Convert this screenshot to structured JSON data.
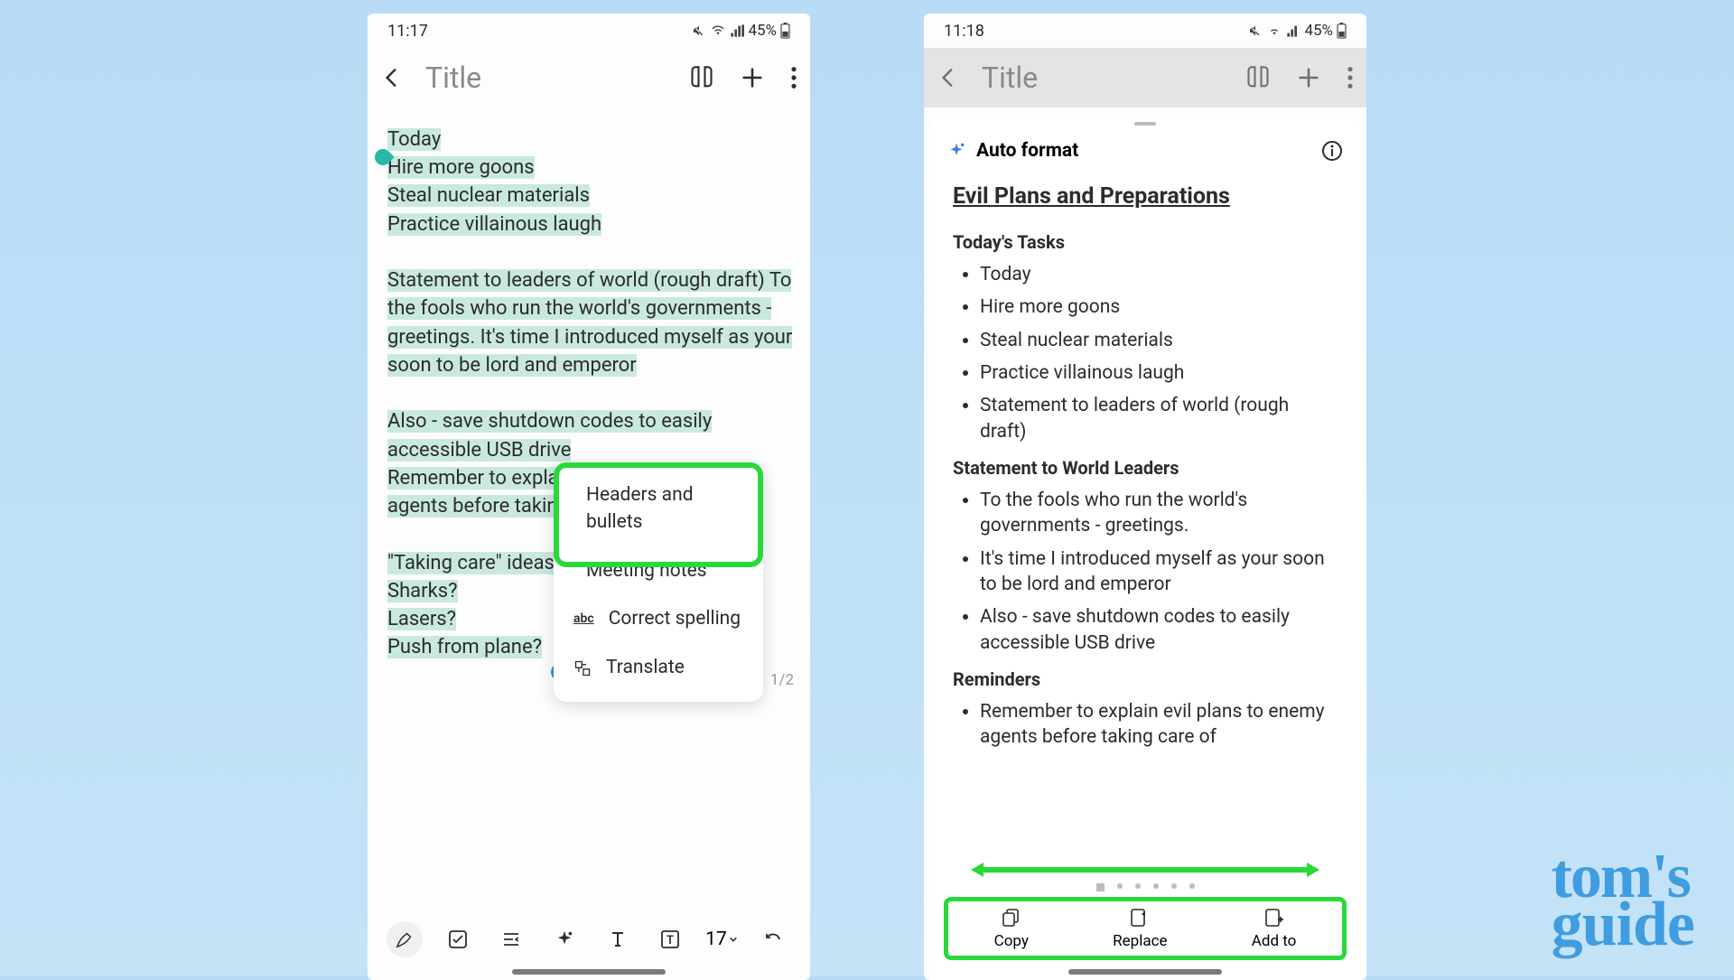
{
  "status": {
    "time_left": "11:17",
    "time_right": "11:18",
    "battery": "45%"
  },
  "header": {
    "title": "Title"
  },
  "note_left": {
    "para1": [
      "Today",
      "Hire more goons",
      "Steal nuclear materials",
      "Practice villainous laugh"
    ],
    "para2": "Statement to leaders of world (rough draft) To the fools who run the world's governments - greetings. It's time I introduced myself as your soon to be lord and emperor",
    "para3": "Also - save shutdown codes to easily accessible USB drive\nRemember to explain evil plans to enemy agents before taking care of them",
    "para4": [
      "\"Taking care\" ideas",
      "Sharks?",
      "Lasers?",
      "Push from plane?"
    ],
    "page_counter": "1/2"
  },
  "context_menu": {
    "items": [
      {
        "label": "Headers and bullets"
      },
      {
        "label": "Meeting notes"
      },
      {
        "label": "Correct spelling",
        "icon": "abc"
      },
      {
        "label": "Translate",
        "icon": "translate"
      }
    ]
  },
  "toolbar_font_size": "17",
  "auto_format": {
    "header": "Auto format",
    "doc_title": "Evil Plans and Preparations",
    "sections": [
      {
        "title": "Today's Tasks",
        "bullets": [
          "Today",
          "Hire more goons",
          "Steal nuclear materials",
          "Practice villainous laugh",
          "Statement to leaders of world (rough draft)"
        ]
      },
      {
        "title": "Statement to World Leaders",
        "bullets": [
          "To the fools who run the world's governments - greetings.",
          "It's time I introduced myself as your soon to be lord and emperor",
          "Also - save shutdown codes to easily accessible USB drive"
        ]
      },
      {
        "title": "Reminders",
        "bullets": [
          "Remember to explain evil plans to enemy agents before taking care of"
        ]
      }
    ],
    "actions": {
      "copy": "Copy",
      "replace": "Replace",
      "addto": "Add to"
    }
  },
  "watermark": {
    "line1": "tom's",
    "line2": "guide"
  }
}
